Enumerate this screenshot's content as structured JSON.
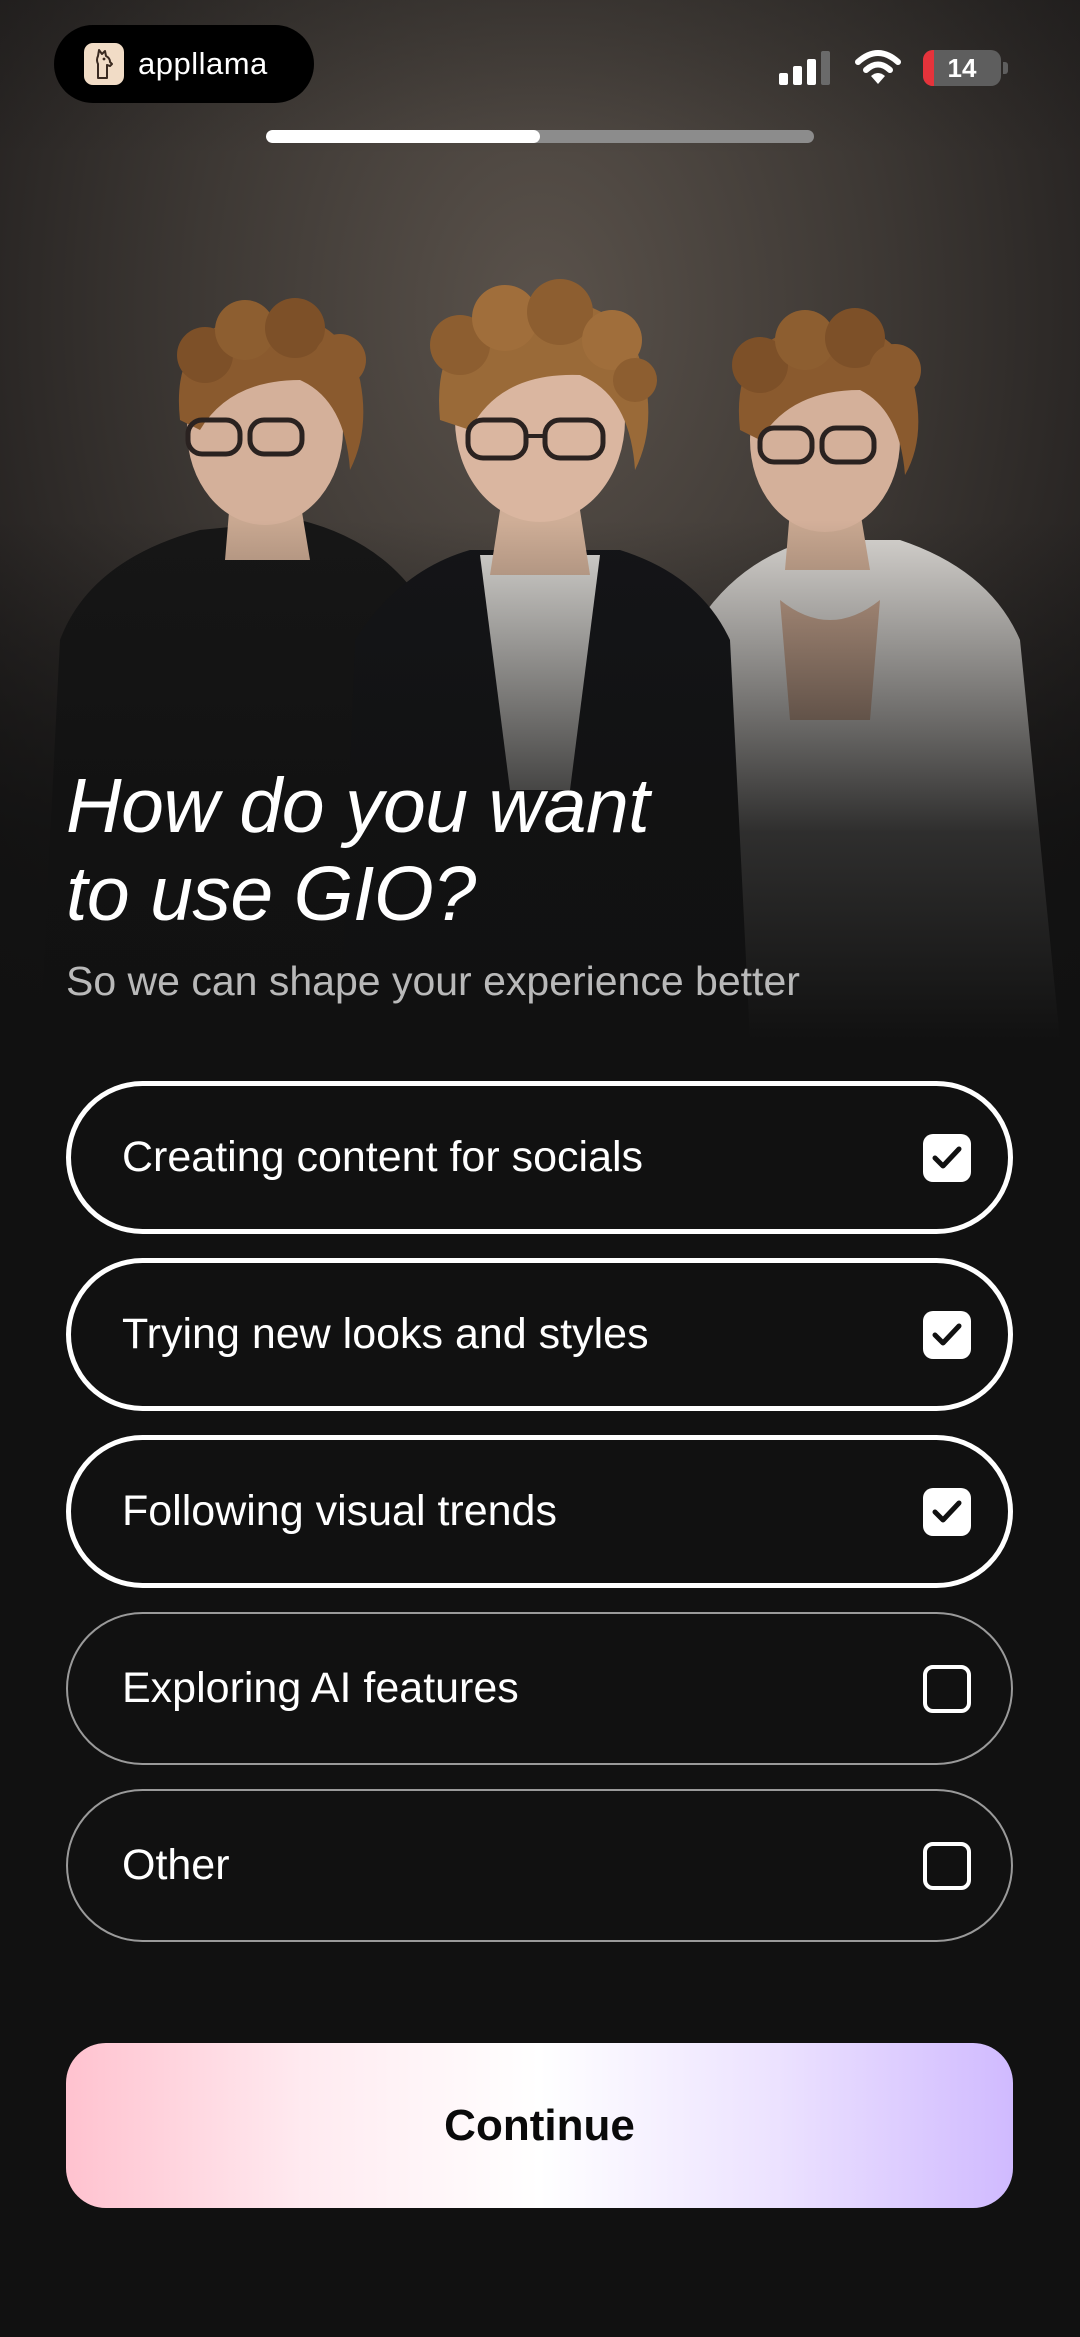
{
  "status_bar": {
    "app_name": "appllama",
    "battery_level": "14",
    "battery_fraction": 0.14
  },
  "progress": {
    "fraction": 0.5
  },
  "title": {
    "line1": "How do you want",
    "line2": "to use GIO?"
  },
  "subtitle": "So we can shape your experience better",
  "options": [
    {
      "label": "Creating content for socials",
      "selected": true
    },
    {
      "label": "Trying new looks and styles",
      "selected": true
    },
    {
      "label": "Following visual trends",
      "selected": true
    },
    {
      "label": "Exploring AI features",
      "selected": false
    },
    {
      "label": "Other",
      "selected": false
    }
  ],
  "continue_label": "Continue",
  "colors": {
    "background": "#111111",
    "continue_gradient_start": "#ffc2cf",
    "continue_gradient_end": "#d0baff"
  }
}
